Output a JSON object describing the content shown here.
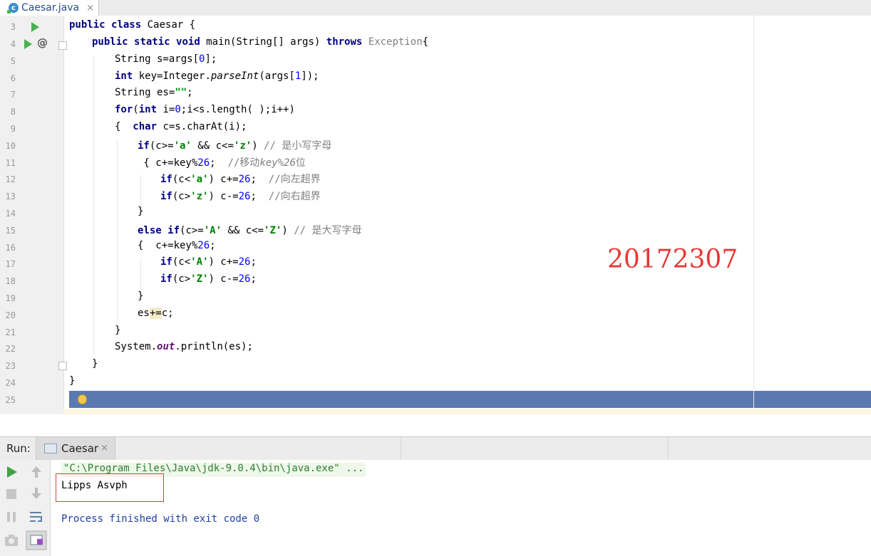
{
  "tab": {
    "filename": "Caesar.java",
    "close": "×",
    "class_icon_letter": "c"
  },
  "editor": {
    "line_numbers": [
      "3",
      "4",
      "5",
      "6",
      "7",
      "8",
      "9",
      "10",
      "11",
      "12",
      "13",
      "14",
      "15",
      "16",
      "17",
      "18",
      "19",
      "20",
      "21",
      "22",
      "23",
      "24",
      "25"
    ],
    "watermark": "20172307",
    "tokens": {
      "public": "public",
      "class": "class",
      "static": "static",
      "void": "void",
      "throws": "throws",
      "int": "int",
      "for": "for",
      "char": "char",
      "if": "if",
      "else": "else",
      "class_name": " Caesar {",
      "main_sig": " main(String[] args) ",
      "exception": " Exception",
      "brace_open": "{",
      "l5_a": "String s=args[",
      "l5_b": "0",
      "l5_c": "];",
      "l6_a": " key=Integer.",
      "l6_b": "parseInt",
      "l6_c": "(args[",
      "l6_d": "1",
      "l6_e": "]);",
      "l7_a": "String es=",
      "l7_b": "\"\"",
      "l7_c": ";",
      "l8_a": "(",
      "l8_b": " i=",
      "l8_c": "0",
      "l8_d": ";i<s.length( );i++)",
      "l9_a": "{  ",
      "l9_b": " c=s.charAt(i);",
      "l10_a": "(c>=",
      "l10_b": "'a'",
      "l10_c": " && c<=",
      "l10_d": "'z'",
      "l10_e": ") ",
      "l10_f": "// 是小写字母",
      "l11_a": " { c+=key%",
      "l11_b": "26",
      "l11_c": ";  ",
      "l11_d": "//移动",
      "l11_e": "key%26",
      "l11_f": "位",
      "l12_a": "(c<",
      "l12_b": "'a'",
      "l12_c": ") c+=",
      "l12_d": "26",
      "l12_e": ";  ",
      "l12_f": "//向左超界",
      "l13_a": "(c>",
      "l13_b": "'z'",
      "l13_c": ") c-=",
      "l13_d": "26",
      "l13_e": ";  ",
      "l13_f": "//向右超界",
      "close_brace": "}",
      "l15_a": " ",
      "l15_b": "(c>=",
      "l15_c": "'A'",
      "l15_d": " && c<=",
      "l15_e": "'Z'",
      "l15_f": ") ",
      "l15_g": "// 是大写字母",
      "l16_a": "{  c+=key%",
      "l16_b": "26",
      "l16_c": ";",
      "l17_a": "(c<",
      "l17_b": "'A'",
      "l17_c": ") c+=",
      "l17_d": "26",
      "l17_e": ";",
      "l18_a": "(c>",
      "l18_b": "'Z'",
      "l18_c": ") c-=",
      "l18_d": "26",
      "l18_e": ";",
      "l20_a": "es",
      "l20_b": "+=",
      "l20_c": "c;",
      "l22_a": "System.",
      "l22_b": "out",
      "l22_c": ".println(es);"
    }
  },
  "run_panel": {
    "label": "Run:",
    "tab_label": "Caesar",
    "tab_close": "×",
    "command": "\"C:\\Program Files\\Java\\jdk-9.0.4\\bin\\java.exe\" ...",
    "output": "Lipps Asvph",
    "exit_message": "Process finished with exit code 0"
  },
  "colors": {
    "keyword": "#000080",
    "number": "#0000ff",
    "string": "#008000",
    "comment": "#808080",
    "watermark": "#e53935",
    "current_line": "#5b78b0"
  }
}
